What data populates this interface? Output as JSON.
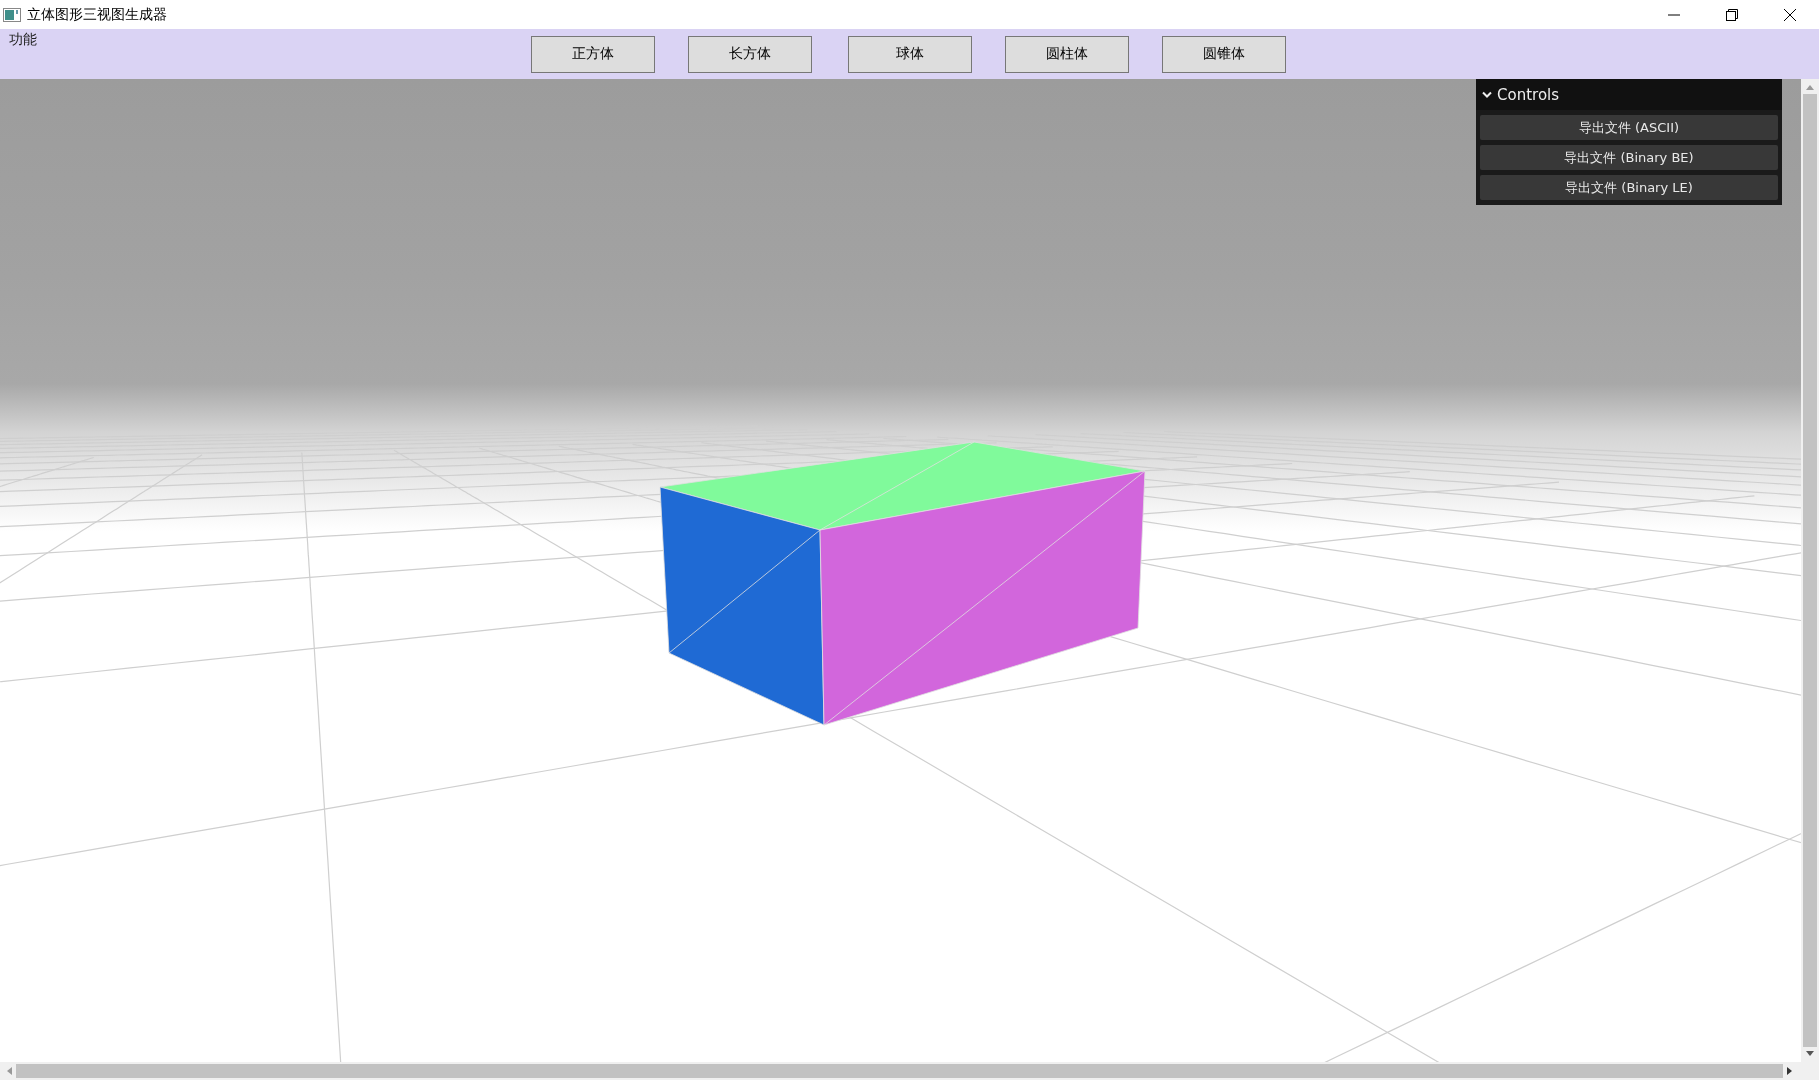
{
  "window": {
    "title": "立体图形三视图生成器"
  },
  "menu": {
    "label": "功能"
  },
  "shape_buttons": [
    {
      "label": "正方体"
    },
    {
      "label": "长方体"
    },
    {
      "label": "球体"
    },
    {
      "label": "圆柱体"
    },
    {
      "label": "圆锥体"
    }
  ],
  "controls_panel": {
    "title": "Controls",
    "expanded": true,
    "buttons": [
      {
        "label": "导出文件 (ASCII)"
      },
      {
        "label": "导出文件 (Binary BE)"
      },
      {
        "label": "导出文件 (Binary LE)"
      }
    ]
  }
}
